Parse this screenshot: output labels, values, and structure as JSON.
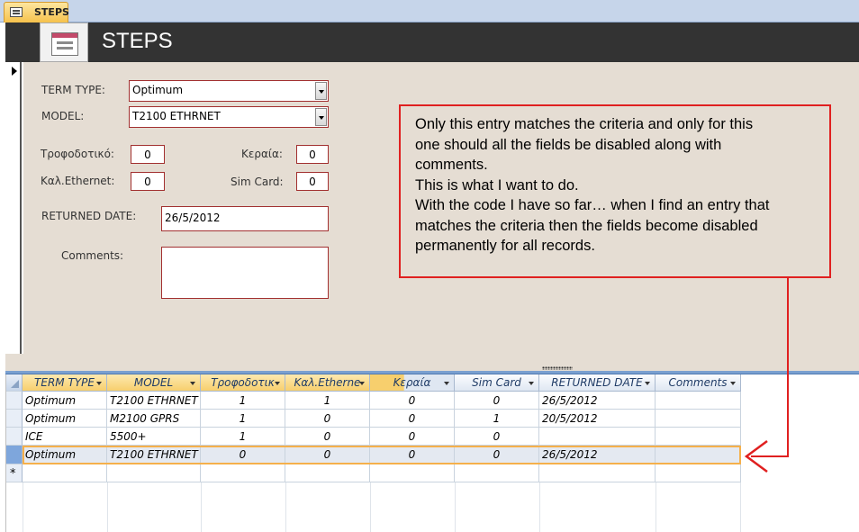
{
  "tab": {
    "label": "STEPS",
    "icon": "form-icon"
  },
  "header": {
    "title": "STEPS",
    "logo_icon": "form-icon"
  },
  "form": {
    "term_type_label": "TERM TYPE:",
    "term_type_value": "Optimum",
    "model_label": "MODEL:",
    "model_value": "T2100 ETHRNET",
    "trofodotiko_label": "Τροφοδοτικό:",
    "trofodotiko_value": "0",
    "keraia_label": "Κεραία:",
    "keraia_value": "0",
    "kal_ethernet_label": "Καλ.Ethernet:",
    "kal_ethernet_value": "0",
    "sim_card_label": "Sim Card:",
    "sim_card_value": "0",
    "returned_date_label": "RETURNED DATE:",
    "returned_date_value": "26/5/2012",
    "comments_label": "Comments:",
    "comments_value": ""
  },
  "annotation": {
    "lines": [
      "Only this entry matches the criteria and only for this",
      "one should all the fields be disabled along with",
      "comments.",
      "This is what  I want to do.",
      "With the code I have so far… when I find an entry that",
      "matches the criteria then the fields become disabled",
      "permanently for all records."
    ],
    "color": "#e02020"
  },
  "datasheet": {
    "columns": [
      "TERM TYPE",
      "MODEL",
      "Τροφοδοτικ",
      "Καλ.Etherne",
      "Κεραία",
      "Sim Card",
      "RETURNED DATE",
      "Comments"
    ],
    "rows": [
      [
        "Optimum",
        "T2100 ETHRNET",
        "1",
        "1",
        "0",
        "0",
        "26/5/2012",
        ""
      ],
      [
        "Optimum",
        "M2100 GPRS",
        "1",
        "0",
        "0",
        "1",
        "20/5/2012",
        ""
      ],
      [
        "ICE",
        "5500+",
        "1",
        "0",
        "0",
        "0",
        "",
        ""
      ],
      [
        "Optimum",
        "T2100 ETHRNET",
        "0",
        "0",
        "0",
        "0",
        "26/5/2012",
        ""
      ]
    ],
    "current_row": 3,
    "new_row_marker": "*"
  }
}
